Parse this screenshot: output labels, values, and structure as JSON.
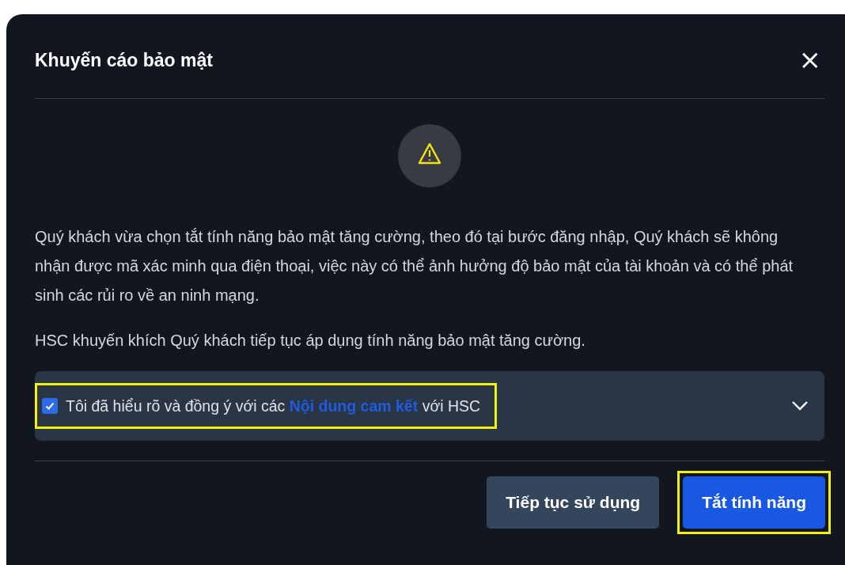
{
  "dialog": {
    "title": "Khuyến cáo bảo mật",
    "close": "×"
  },
  "paragraphs": [
    "Quý khách vừa chọn tắt tính năng bảo mật tăng cường, theo đó tại bước đăng nhập, Quý khách sẽ không nhận được mã xác minh qua điện thoại, việc này có thể ảnh hưởng độ bảo mật của tài khoản và có thể phát sinh các rủi ro về an ninh mạng.",
    "HSC khuyến khích Quý khách tiếp tục áp dụng tính năng bảo mật tăng cường."
  ],
  "agreement": {
    "checked": true,
    "highlighted": true,
    "expanded": false,
    "text_before": "Tôi đã hiểu rõ và đồng ý với các ",
    "link": "Nội dung cam kết",
    "text_after": " với HSC"
  },
  "buttons": [
    {
      "label": "Tiếp tục sử dụng",
      "kind": "secondary",
      "highlighted": false
    },
    {
      "label": "Tắt tính năng",
      "kind": "primary",
      "highlighted": true
    }
  ]
}
